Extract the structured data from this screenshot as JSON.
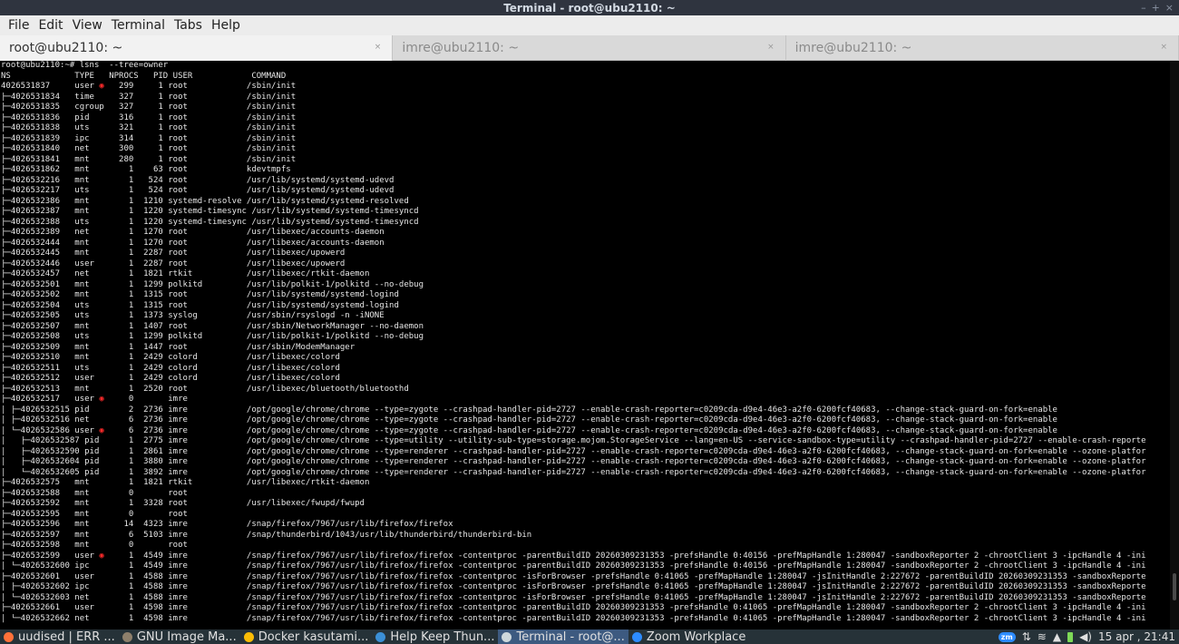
{
  "window": {
    "title": "Terminal - root@ubu2110: ~",
    "controls": [
      "–",
      "+",
      "×"
    ]
  },
  "menu": [
    "File",
    "Edit",
    "View",
    "Terminal",
    "Tabs",
    "Help"
  ],
  "tabs": [
    {
      "label": "root@ubu2110: ~",
      "active": true
    },
    {
      "label": "imre@ubu2110: ~",
      "active": false
    },
    {
      "label": "imre@ubu2110: ~",
      "active": false
    }
  ],
  "tab_close_glyph": "×",
  "terminal": {
    "marker_color": "#ff2a2a",
    "lines": [
      "root@ubu2110:~# lsns  --tree=owner",
      "NS             TYPE   NPROCS   PID USER            COMMAND",
      "4026531837     user ◉   299     1 root            /sbin/init",
      "├─4026531834   time     327     1 root            /sbin/init",
      "├─4026531835   cgroup   327     1 root            /sbin/init",
      "├─4026531836   pid      316     1 root            /sbin/init",
      "├─4026531838   uts      321     1 root            /sbin/init",
      "├─4026531839   ipc      314     1 root            /sbin/init",
      "├─4026531840   net      300     1 root            /sbin/init",
      "├─4026531841   mnt      280     1 root            /sbin/init",
      "├─4026531862   mnt        1    63 root            kdevtmpfs",
      "├─4026532216   mnt        1   524 root            /usr/lib/systemd/systemd-udevd",
      "├─4026532217   uts        1   524 root            /usr/lib/systemd/systemd-udevd",
      "├─4026532386   mnt        1  1210 systemd-resolve /usr/lib/systemd/systemd-resolved",
      "├─4026532387   mnt        1  1220 systemd-timesync /usr/lib/systemd/systemd-timesyncd",
      "├─4026532388   uts        1  1220 systemd-timesync /usr/lib/systemd/systemd-timesyncd",
      "├─4026532389   net        1  1270 root            /usr/libexec/accounts-daemon",
      "├─4026532444   mnt        1  1270 root            /usr/libexec/accounts-daemon",
      "├─4026532445   mnt        1  2287 root            /usr/libexec/upowerd",
      "├─4026532446   user       1  2287 root            /usr/libexec/upowerd",
      "├─4026532457   net        1  1821 rtkit           /usr/libexec/rtkit-daemon",
      "├─4026532501   mnt        1  1299 polkitd         /usr/lib/polkit-1/polkitd --no-debug",
      "├─4026532502   mnt        1  1315 root            /usr/lib/systemd/systemd-logind",
      "├─4026532504   uts        1  1315 root            /usr/lib/systemd/systemd-logind",
      "├─4026532505   uts        1  1373 syslog          /usr/sbin/rsyslogd -n -iNONE",
      "├─4026532507   mnt        1  1407 root            /usr/sbin/NetworkManager --no-daemon",
      "├─4026532508   uts        1  1299 polkitd         /usr/lib/polkit-1/polkitd --no-debug",
      "├─4026532509   mnt        1  1447 root            /usr/sbin/ModemManager",
      "├─4026532510   mnt        1  2429 colord          /usr/libexec/colord",
      "├─4026532511   uts        1  2429 colord          /usr/libexec/colord",
      "├─4026532512   user       1  2429 colord          /usr/libexec/colord",
      "├─4026532513   mnt        1  2520 root            /usr/libexec/bluetooth/bluetoothd",
      "├─4026532517   user ◉     0       imre",
      "│ ├─4026532515 pid        2  2736 imre            /opt/google/chrome/chrome --type=zygote --crashpad-handler-pid=2727 --enable-crash-reporter=c0209cda-d9e4-46e3-a2f0-6200fcf40683, --change-stack-guard-on-fork=enable",
      "│ ├─4026532516 net        6  2736 imre            /opt/google/chrome/chrome --type=zygote --crashpad-handler-pid=2727 --enable-crash-reporter=c0209cda-d9e4-46e3-a2f0-6200fcf40683, --change-stack-guard-on-fork=enable",
      "│ └─4026532586 user ◉     6  2736 imre            /opt/google/chrome/chrome --type=zygote --crashpad-handler-pid=2727 --enable-crash-reporter=c0209cda-d9e4-46e3-a2f0-6200fcf40683, --change-stack-guard-on-fork=enable",
      "│   ├─4026532587 pid      1  2775 imre            /opt/google/chrome/chrome --type=utility --utility-sub-type=storage.mojom.StorageService --lang=en-US --service-sandbox-type=utility --crashpad-handler-pid=2727 --enable-crash-reporte",
      "│   ├─4026532590 pid      1  2861 imre            /opt/google/chrome/chrome --type=renderer --crashpad-handler-pid=2727 --enable-crash-reporter=c0209cda-d9e4-46e3-a2f0-6200fcf40683, --change-stack-guard-on-fork=enable --ozone-platfor",
      "│   ├─4026532604 pid      1  3880 imre            /opt/google/chrome/chrome --type=renderer --crashpad-handler-pid=2727 --enable-crash-reporter=c0209cda-d9e4-46e3-a2f0-6200fcf40683, --change-stack-guard-on-fork=enable --ozone-platfor",
      "│   └─4026532605 pid      1  3892 imre            /opt/google/chrome/chrome --type=renderer --crashpad-handler-pid=2727 --enable-crash-reporter=c0209cda-d9e4-46e3-a2f0-6200fcf40683, --change-stack-guard-on-fork=enable --ozone-platfor",
      "├─4026532575   mnt        1  1821 rtkit           /usr/libexec/rtkit-daemon",
      "├─4026532588   mnt        0       root",
      "├─4026532592   mnt        1  3328 root            /usr/libexec/fwupd/fwupd",
      "├─4026532595   mnt        0       root",
      "├─4026532596   mnt       14  4323 imre            /snap/firefox/7967/usr/lib/firefox/firefox",
      "├─4026532597   mnt        6  5103 imre            /snap/thunderbird/1043/usr/lib/thunderbird/thunderbird-bin",
      "├─4026532598   mnt        0       root",
      "├─4026532599   user ◉     1  4549 imre            /snap/firefox/7967/usr/lib/firefox/firefox -contentproc -parentBuildID 20260309231353 -prefsHandle 0:40156 -prefMapHandle 1:280047 -sandboxReporter 2 -chrootClient 3 -ipcHandle 4 -ini",
      "│ └─4026532600 ipc        1  4549 imre            /snap/firefox/7967/usr/lib/firefox/firefox -contentproc -parentBuildID 20260309231353 -prefsHandle 0:40156 -prefMapHandle 1:280047 -sandboxReporter 2 -chrootClient 3 -ipcHandle 4 -ini",
      "├─4026532601   user       1  4588 imre            /snap/firefox/7967/usr/lib/firefox/firefox -contentproc -isForBrowser -prefsHandle 0:41065 -prefMapHandle 1:280047 -jsInitHandle 2:227672 -parentBuildID 20260309231353 -sandboxReporte",
      "│ ├─4026532602 ipc        1  4588 imre            /snap/firefox/7967/usr/lib/firefox/firefox -contentproc -isForBrowser -prefsHandle 0:41065 -prefMapHandle 1:280047 -jsInitHandle 2:227672 -parentBuildID 20260309231353 -sandboxReporte",
      "│ └─4026532603 net        1  4588 imre            /snap/firefox/7967/usr/lib/firefox/firefox -contentproc -isForBrowser -prefsHandle 0:41065 -prefMapHandle 1:280047 -jsInitHandle 2:227672 -parentBuildID 20260309231353 -sandboxReporte",
      "├─4026532661   user       1  4598 imre            /snap/firefox/7967/usr/lib/firefox/firefox -contentproc -parentBuildID 20260309231353 -prefsHandle 0:41065 -prefMapHandle 1:280047 -sandboxReporter 2 -chrootClient 3 -ipcHandle 4 -ini",
      "│ └─4026532662 net        1  4598 imre            /snap/firefox/7967/usr/lib/firefox/firefox -contentproc -parentBuildID 20260309231353 -prefsHandle 0:41065 -prefMapHandle 1:280047 -sandboxReporter 2 -chrootClient 3 -ipcHandle 4 -ini"
    ]
  },
  "taskbar": {
    "items": [
      {
        "label": "uudised | ERR ...",
        "icon": "firefox-icon",
        "color": "#ff7139",
        "active": false
      },
      {
        "label": "GNU Image Ma...",
        "icon": "gimp-icon",
        "color": "#8e7f6b",
        "active": false
      },
      {
        "label": "Docker kasutami...",
        "icon": "chrome-icon",
        "color": "#fbbc05",
        "active": false
      },
      {
        "label": "Help Keep Thun...",
        "icon": "thunderbird-icon",
        "color": "#3b8fd6",
        "active": false
      },
      {
        "label": "Terminal - root@...",
        "icon": "terminal-icon",
        "color": "#cfd8dc",
        "active": true
      },
      {
        "label": "Zoom Workplace",
        "icon": "zoom-icon",
        "color": "#2d8cff",
        "active": false
      }
    ],
    "tray": {
      "zoom_badge": "zm",
      "clock": "15 apr , 21:41"
    }
  }
}
